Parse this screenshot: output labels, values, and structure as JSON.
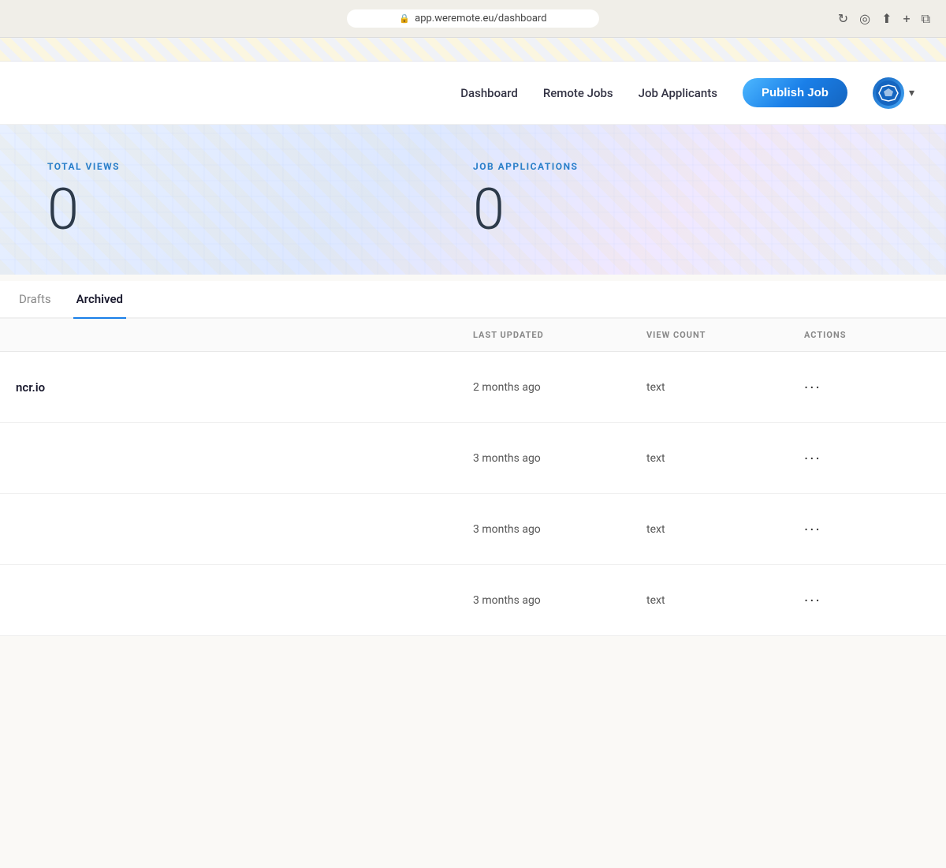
{
  "browser": {
    "url": "app.weremote.eu/dashboard"
  },
  "navbar": {
    "links": [
      {
        "id": "dashboard",
        "label": "Dashboard"
      },
      {
        "id": "remote-jobs",
        "label": "Remote Jobs"
      },
      {
        "id": "job-applicants",
        "label": "Job Applicants"
      }
    ],
    "publish_button": "Publish Job"
  },
  "stats": {
    "total_views_label": "TOTAL VIEWS",
    "total_views_value": "0",
    "job_applications_label": "JOB APPLICATIONS",
    "job_applications_value": "0"
  },
  "tabs": [
    {
      "id": "drafts",
      "label": "Drafts",
      "active": false
    },
    {
      "id": "archived",
      "label": "Archived",
      "active": true
    }
  ],
  "table": {
    "columns": [
      {
        "id": "job",
        "label": ""
      },
      {
        "id": "last-updated",
        "label": "LAST UPDATED"
      },
      {
        "id": "view-count",
        "label": "VIEW COUNT"
      },
      {
        "id": "actions",
        "label": "ACTIONS"
      }
    ],
    "rows": [
      {
        "id": "row-1",
        "job_title": "ncr.io",
        "job_subtitle": "",
        "last_updated": "2 months ago",
        "view_count": "text",
        "actions": "···"
      },
      {
        "id": "row-2",
        "job_title": "",
        "job_subtitle": "",
        "last_updated": "3 months ago",
        "view_count": "text",
        "actions": "···"
      },
      {
        "id": "row-3",
        "job_title": "",
        "job_subtitle": "",
        "last_updated": "3 months ago",
        "view_count": "text",
        "actions": "···"
      },
      {
        "id": "row-4",
        "job_title": "",
        "job_subtitle": "",
        "last_updated": "3 months ago",
        "view_count": "text",
        "actions": "···"
      }
    ]
  },
  "colors": {
    "accent_blue": "#1a7fe8",
    "stat_label_color": "#2a7fc9",
    "publish_btn_start": "#4db8ff",
    "publish_btn_end": "#1565c0"
  }
}
